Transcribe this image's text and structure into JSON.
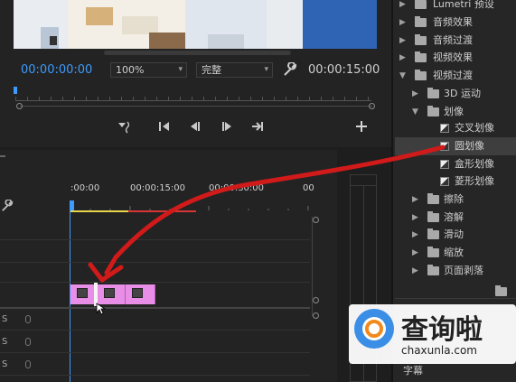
{
  "monitor": {
    "current_timecode": "00:00:00:00",
    "zoom": "100%",
    "quality": "完整",
    "total_timecode": "00:00:15:00",
    "icons": [
      "wrench-icon",
      "marker-icon",
      "step-to-in-icon",
      "step-back-icon",
      "play-icon",
      "step-to-out-icon",
      "add-icon"
    ]
  },
  "timeline": {
    "ruler_labels": [
      ":00:00",
      "00:00:15:00",
      "00:00:30:00",
      "00"
    ],
    "track_labels": [
      "S",
      "S",
      "S"
    ],
    "clip_count": 3
  },
  "effects": {
    "items": [
      {
        "label": "Lumetri 预设",
        "kind": "folder",
        "indent": 0
      },
      {
        "label": "音频效果",
        "kind": "folder",
        "indent": 0
      },
      {
        "label": "音频过渡",
        "kind": "folder",
        "indent": 0
      },
      {
        "label": "视频效果",
        "kind": "folder",
        "indent": 0
      },
      {
        "label": "视频过渡",
        "kind": "folder",
        "indent": 0,
        "expanded": true
      },
      {
        "label": "3D 运动",
        "kind": "folder",
        "indent": 1
      },
      {
        "label": "划像",
        "kind": "folder",
        "indent": 1,
        "expanded": true
      },
      {
        "label": "交叉划像",
        "kind": "effect",
        "indent": 2
      },
      {
        "label": "圆划像",
        "kind": "effect",
        "indent": 2,
        "selected": true
      },
      {
        "label": "盒形划像",
        "kind": "effect",
        "indent": 2
      },
      {
        "label": "菱形划像",
        "kind": "effect",
        "indent": 2
      },
      {
        "label": "擦除",
        "kind": "folder",
        "indent": 1
      },
      {
        "label": "溶解",
        "kind": "folder",
        "indent": 1
      },
      {
        "label": "滑动",
        "kind": "folder",
        "indent": 1
      },
      {
        "label": "缩放",
        "kind": "folder",
        "indent": 1
      },
      {
        "label": "页面剥落",
        "kind": "folder",
        "indent": 1
      }
    ],
    "caption": "字幕"
  },
  "watermark": {
    "text": "查询啦",
    "url": "chaxunla.com"
  },
  "colors": {
    "accent_blue": "#3d9bff",
    "clip_pink": "#e98ee7",
    "annotation_red": "#d11a1a",
    "work_area_yellow": "#e7d64c"
  }
}
